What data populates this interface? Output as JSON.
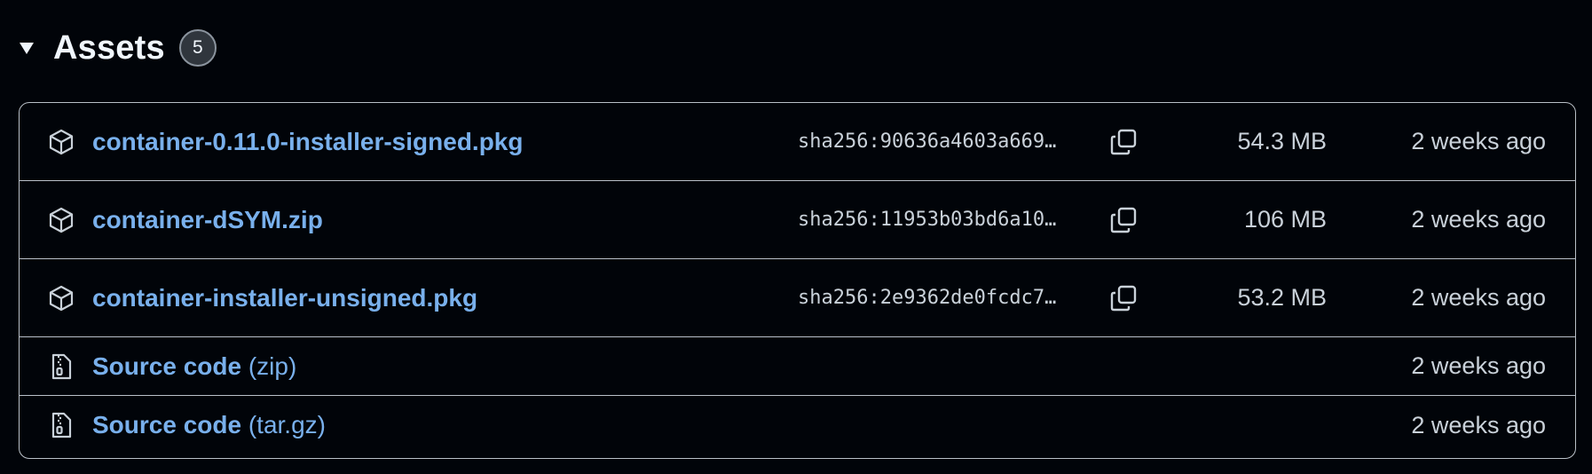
{
  "section": {
    "title": "Assets",
    "count": "5",
    "caret_icon": "triangle-down-icon"
  },
  "assets": [
    {
      "name": "container-0.11.0-installer-signed.pkg",
      "icon": "package-icon",
      "sha": "sha256:90636a4603a669…",
      "size": "54.3 MB",
      "date": "2 weeks ago"
    },
    {
      "name": "container-dSYM.zip",
      "icon": "package-icon",
      "sha": "sha256:11953b03bd6a10…",
      "size": "106 MB",
      "date": "2 weeks ago"
    },
    {
      "name": "container-installer-unsigned.pkg",
      "icon": "package-icon",
      "sha": "sha256:2e9362de0fcdc7…",
      "size": "53.2 MB",
      "date": "2 weeks ago"
    }
  ],
  "sources": [
    {
      "name": "Source code",
      "suffix": "(zip)",
      "icon": "file-zip-icon",
      "date": "2 weeks ago"
    },
    {
      "name": "Source code",
      "suffix": "(tar.gz)",
      "icon": "file-zip-icon",
      "date": "2 weeks ago"
    }
  ],
  "colors": {
    "background": "#010409",
    "link": "#79b0ec",
    "border": "#b9c0c8",
    "text": "#c9d1d9"
  }
}
